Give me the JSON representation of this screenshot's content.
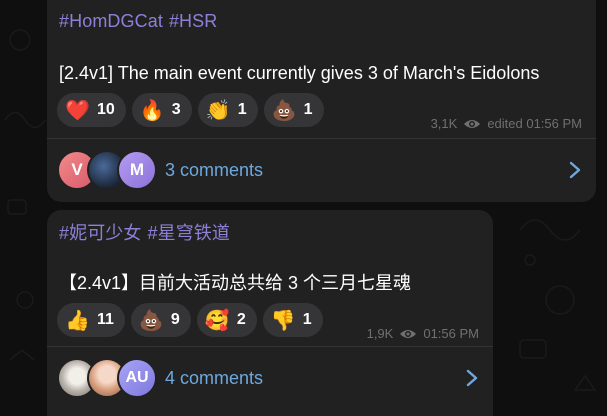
{
  "posts": [
    {
      "tags": [
        "#HomDGCat",
        "#HSR"
      ],
      "message": "[2.4v1] The main event currently gives 3 of March's Eidolons",
      "reactions": [
        {
          "emoji": "❤️",
          "icon": "red-heart-icon",
          "count": "10"
        },
        {
          "emoji": "🔥",
          "icon": "fire-icon",
          "count": "3"
        },
        {
          "emoji": "👏",
          "icon": "clapping-hands-icon",
          "count": "1"
        },
        {
          "emoji": "💩",
          "icon": "pile-of-poo-icon",
          "count": "1"
        }
      ],
      "views": "3,1K",
      "time": "edited 01:56 PM",
      "avatars": [
        "V",
        "",
        "M"
      ],
      "comments_label": "3 comments"
    },
    {
      "tags": [
        "#妮可少女",
        "#星穹铁道"
      ],
      "message": "【2.4v1】目前大活动总共给 3 个三月七星魂",
      "reactions": [
        {
          "emoji": "👍",
          "icon": "thumbs-up-icon",
          "count": "11"
        },
        {
          "emoji": "💩",
          "icon": "pile-of-poo-icon",
          "count": "9"
        },
        {
          "emoji": "🥰",
          "icon": "smiling-face-with-hearts-icon",
          "count": "2"
        },
        {
          "emoji": "👎",
          "icon": "thumbs-down-icon",
          "count": "1"
        }
      ],
      "views": "1,9K",
      "time": "01:56 PM",
      "avatars": [
        "",
        "",
        "AU"
      ],
      "comments_label": "4 comments"
    }
  ],
  "colors": {
    "background": "#0f0f10",
    "card": "#212121",
    "hashtag": "#8f7fd8",
    "link": "#6ea8de",
    "reaction_bg": "#353537",
    "meta": "#707072"
  }
}
